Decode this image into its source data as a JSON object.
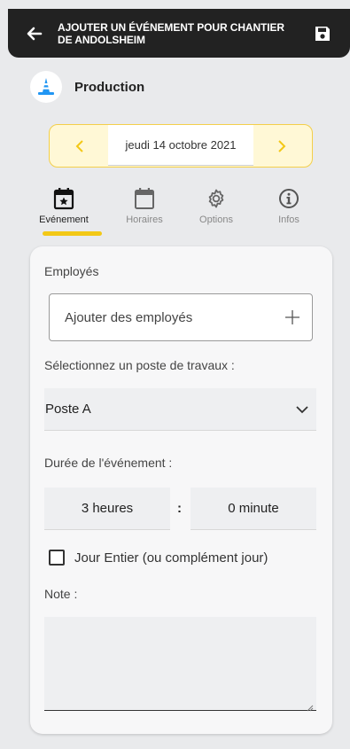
{
  "header": {
    "title": "AJOUTER UN ÉVÉNEMENT POUR CHANTIER DE ANDOLSHEIM",
    "back_icon": "arrow-left-icon",
    "save_icon": "floppy-disk-icon"
  },
  "section": {
    "label": "Production",
    "icon": "traffic-cone-icon"
  },
  "datebar": {
    "date": "jeudi 14 octobre 2021",
    "prev_icon": "chevron-left-icon",
    "next_icon": "chevron-right-icon",
    "accent": "#f3cf4a"
  },
  "tabs": [
    {
      "label": "Evénement",
      "icon": "calendar-star-icon",
      "active": true
    },
    {
      "label": "Horaires",
      "icon": "calendar-icon",
      "active": false
    },
    {
      "label": "Options",
      "icon": "gear-icon",
      "active": false
    },
    {
      "label": "Infos",
      "icon": "info-icon",
      "active": false
    }
  ],
  "form": {
    "employees_label": "Employés",
    "employees_placeholder": "Ajouter des employés",
    "workstation_label": "Sélectionnez un poste de travaux :",
    "workstation_value": "Poste A",
    "duration_label": "Durée de l'événement :",
    "duration_hours": "3 heures",
    "duration_separator": ":",
    "duration_minutes": "0 minute",
    "full_day_label": "Jour Entier (ou complément jour)",
    "full_day_checked": false,
    "note_label": "Note :",
    "note_value": ""
  },
  "colors": {
    "header_bg": "#222222",
    "tab_underline": "#f3c816",
    "cone_blue": "#2196f3"
  }
}
